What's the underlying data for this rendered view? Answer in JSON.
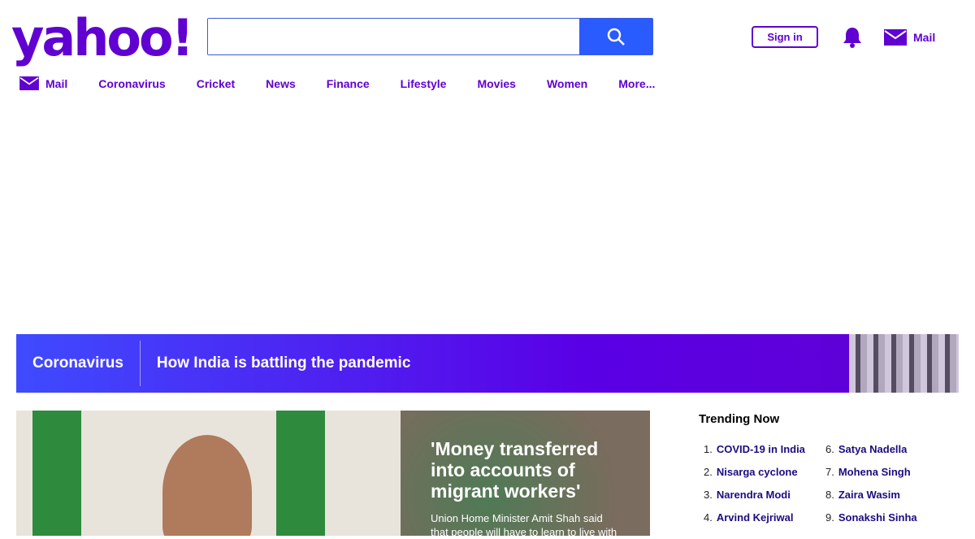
{
  "logo": "yahoo!",
  "search": {
    "placeholder": "",
    "value": ""
  },
  "header": {
    "signin": "Sign in",
    "mail": "Mail"
  },
  "nav": [
    "Mail",
    "Coronavirus",
    "Cricket",
    "News",
    "Finance",
    "Lifestyle",
    "Movies",
    "Women",
    "More..."
  ],
  "banner": {
    "tag": "Coronavirus",
    "title": "How India is battling the pandemic"
  },
  "hero": {
    "headline": "'Money transferred into accounts of migrant workers'",
    "summary": "Union Home Minister Amit Shah said that people will have to learn to live with"
  },
  "trending": {
    "title": "Trending Now",
    "items": [
      {
        "n": "1.",
        "t": "COVID-19 in India"
      },
      {
        "n": "2.",
        "t": "Nisarga cyclone"
      },
      {
        "n": "3.",
        "t": "Narendra Modi"
      },
      {
        "n": "4.",
        "t": "Arvind Kejriwal"
      },
      {
        "n": "6.",
        "t": "Satya Nadella"
      },
      {
        "n": "7.",
        "t": "Mohena Singh"
      },
      {
        "n": "8.",
        "t": "Zaira Wasim"
      },
      {
        "n": "9.",
        "t": "Sonakshi Sinha"
      }
    ]
  }
}
